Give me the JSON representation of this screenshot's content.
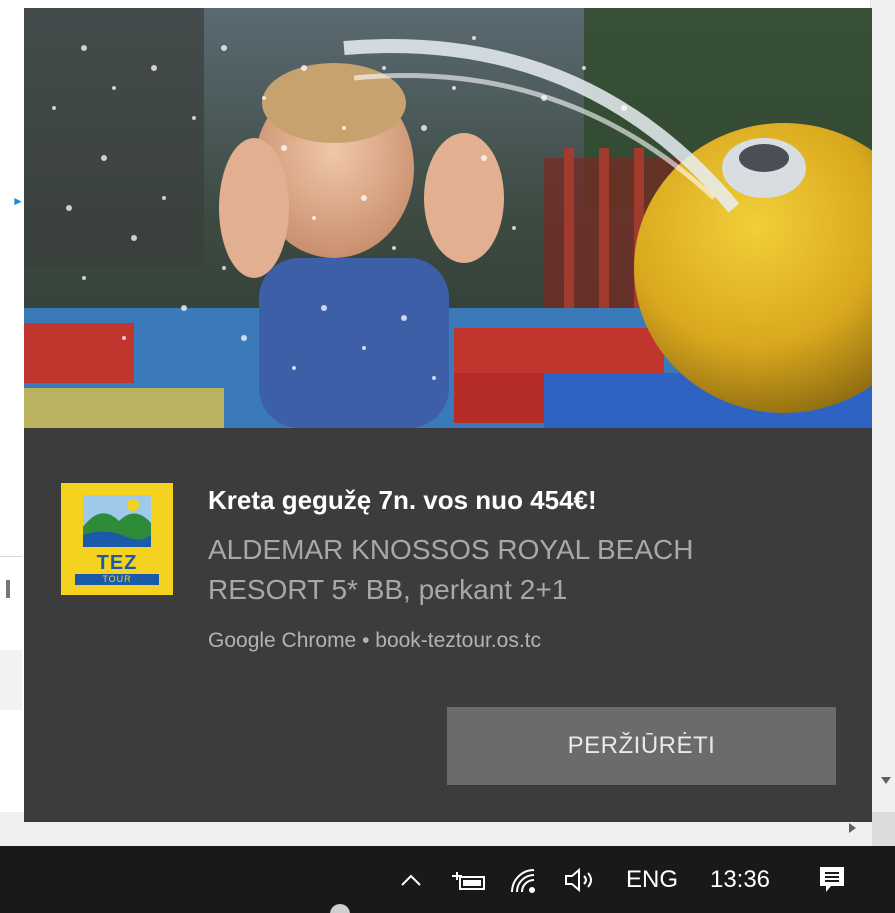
{
  "notification": {
    "title": "Kreta gegužę 7n. vos nuo 454€!",
    "body": "ALDEMAR KNOSSOS ROYAL BEACH RESORT 5* BB, perkant 2+1",
    "attribution": "Google Chrome • book-teztour.os.tc",
    "action_label": "PERŽIŪRĖTI",
    "app_logo": {
      "word": "TEZ",
      "sub": "TOUR",
      "color": "#f4d21f",
      "accent": "#1b5aa8"
    },
    "hero_image_icon": "child-water-splash-image"
  },
  "taskbar": {
    "chevron_icon": "chevron-up-icon",
    "battery_icon": "battery-icon",
    "wifi_icon": "wifi-icon",
    "volume_icon": "volume-icon",
    "language": "ENG",
    "time": "13:36",
    "action_center_icon": "action-center-icon"
  },
  "colors": {
    "toast_bg": "#3c3c3c",
    "button_bg": "#6b6b6b",
    "taskbar_bg": "#191919"
  }
}
